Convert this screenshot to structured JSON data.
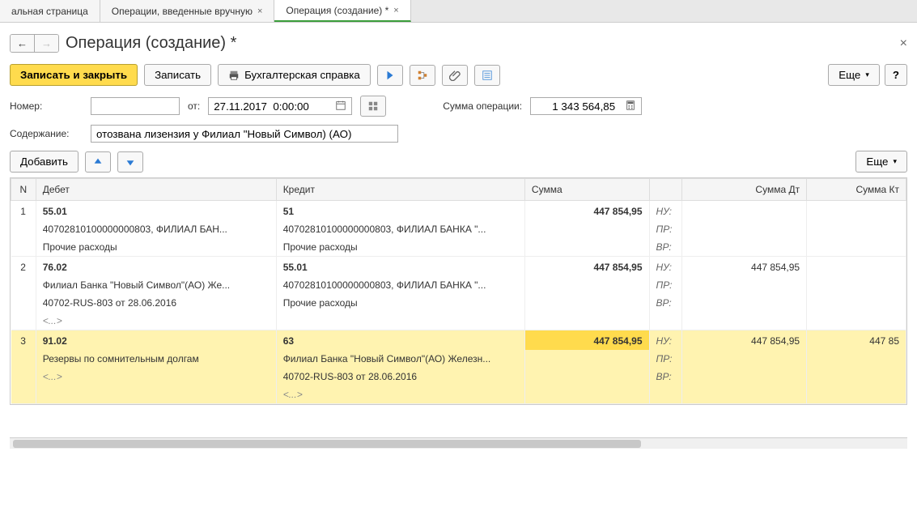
{
  "tabs": [
    {
      "label": "альная страница",
      "closable": false,
      "active": false
    },
    {
      "label": "Операции, введенные вручную",
      "closable": true,
      "active": false
    },
    {
      "label": "Операция (создание) *",
      "closable": true,
      "active": true
    }
  ],
  "page_title": "Операция (создание) *",
  "toolbar": {
    "save_close": "Записать и закрыть",
    "save": "Записать",
    "report": "Бухгалтерская справка",
    "more": "Еще",
    "help": "?"
  },
  "form": {
    "number_label": "Номер:",
    "number_value": "",
    "from_label": "от:",
    "date_value": "27.11.2017  0:00:00",
    "sum_label": "Сумма операции:",
    "sum_value": "1 343 564,85",
    "desc_label": "Содержание:",
    "desc_value": "отозвана лизензия у Филиал \"Новый Символ) (АО)"
  },
  "sub_toolbar": {
    "add": "Добавить",
    "more": "Еще"
  },
  "table": {
    "headers": {
      "n": "N",
      "debit": "Дебет",
      "credit": "Кредит",
      "sum": "Сумма",
      "sum_dt": "Сумма Дт",
      "sum_kt": "Сумма Кт"
    },
    "tags": {
      "nu": "НУ:",
      "pr": "ПР:",
      "vr": "ВР:"
    },
    "placeholder": "<...>",
    "rows": [
      {
        "n": "1",
        "debit_acc": "55.01",
        "credit_acc": "51",
        "sum": "447 854,95",
        "debit_l2": "40702810100000000803, ФИЛИАЛ БАН...",
        "credit_l2": "40702810100000000803, ФИЛИАЛ БАНКА \"...",
        "debit_l3": "Прочие расходы",
        "credit_l3": "Прочие расходы",
        "dt": "",
        "kt": "",
        "selected": false
      },
      {
        "n": "2",
        "debit_acc": "76.02",
        "credit_acc": "55.01",
        "sum": "447 854,95",
        "debit_l2": "Филиал Банка \"Новый Символ\"(АО) Же...",
        "credit_l2": "40702810100000000803, ФИЛИАЛ БАНКА \"...",
        "debit_l3": "40702-RUS-803 от 28.06.2016",
        "credit_l3": "Прочие расходы",
        "debit_l4": "<...>",
        "dt": "447 854,95",
        "kt": "",
        "selected": false
      },
      {
        "n": "3",
        "debit_acc": "91.02",
        "credit_acc": "63",
        "sum": "447 854,95",
        "debit_l2": "Резервы по сомнительным долгам",
        "credit_l2": "Филиал Банка \"Новый Символ\"(АО) Железн...",
        "debit_l3": "<...>",
        "credit_l3": "40702-RUS-803 от 28.06.2016",
        "credit_l4": "<...>",
        "dt": "447 854,95",
        "kt": "447 85",
        "selected": true
      }
    ]
  }
}
